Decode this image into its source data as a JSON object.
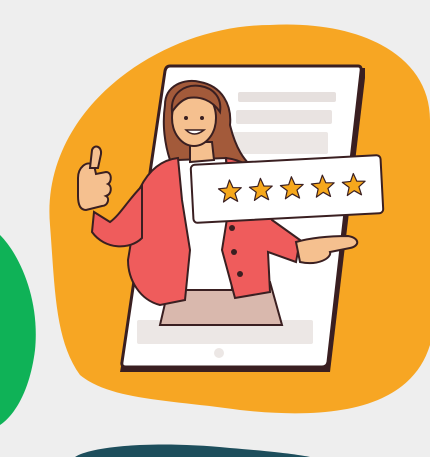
{
  "illustration": {
    "subject": "woman-thumbs-up-from-phone",
    "rating": {
      "stars_filled": 5,
      "stars_total": 5
    },
    "colors": {
      "background": "#eeeeee",
      "orange_blob": "#f7a623",
      "green_blob": "#0fb257",
      "teal_blob": "#1d4e5c",
      "phone_body": "#ffffff",
      "phone_outline": "#3a1f21",
      "jacket": "#ef5c5c",
      "jacket_dark": "#c9403f",
      "shirt": "#ffffff",
      "skin": "#f5c08f",
      "hair": "#a35a3a",
      "pants": "#d9b8ad",
      "star": "#f6a81c",
      "rating_card": "#ffffff"
    }
  }
}
